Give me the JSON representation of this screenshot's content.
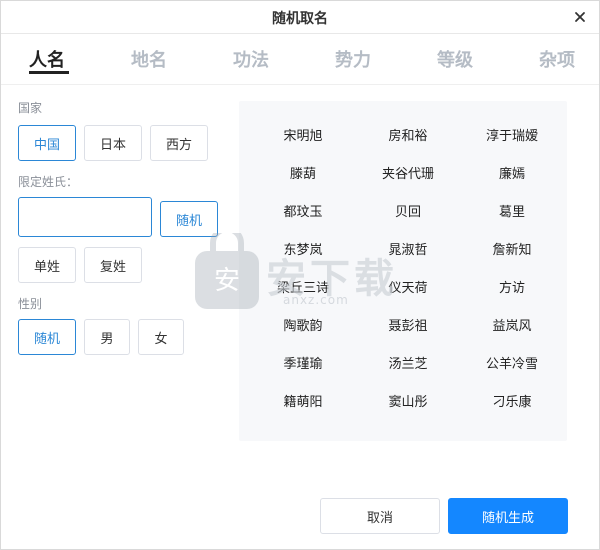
{
  "window": {
    "title": "随机取名"
  },
  "tabs": [
    "人名",
    "地名",
    "功法",
    "势力",
    "等级",
    "杂项"
  ],
  "country": {
    "label": "国家",
    "options": [
      "中国",
      "日本",
      "西方"
    ],
    "selected": "中国"
  },
  "surname": {
    "label": "限定姓氏：",
    "input_value": "",
    "random_label": "随机",
    "types": [
      "单姓",
      "复姓"
    ]
  },
  "gender": {
    "label": "性别",
    "options": [
      "随机",
      "男",
      "女"
    ],
    "selected": "随机"
  },
  "names": [
    "宋明旭",
    "房和裕",
    "淳于瑞嫒",
    "滕葫",
    "夹谷代珊",
    "廉嫣",
    "都玟玉",
    "贝回",
    "葛里",
    "东梦岚",
    "晁淑哲",
    "詹新知",
    "梁丘三诗",
    "仪天荷",
    "方访",
    "陶歌韵",
    "聂彭祖",
    "益岚风",
    "季瑾瑜",
    "汤兰芝",
    "公羊冷雪",
    "籍萌阳",
    "窦山彤",
    "刁乐康"
  ],
  "footer": {
    "cancel_label": "取消",
    "generate_label": "随机生成"
  },
  "watermark": {
    "text": "安下载",
    "sub": "anxz.com"
  },
  "colors": {
    "accent": "#2b87d6",
    "primary_button": "#1487ff",
    "panel_bg": "#f7f8fa"
  }
}
